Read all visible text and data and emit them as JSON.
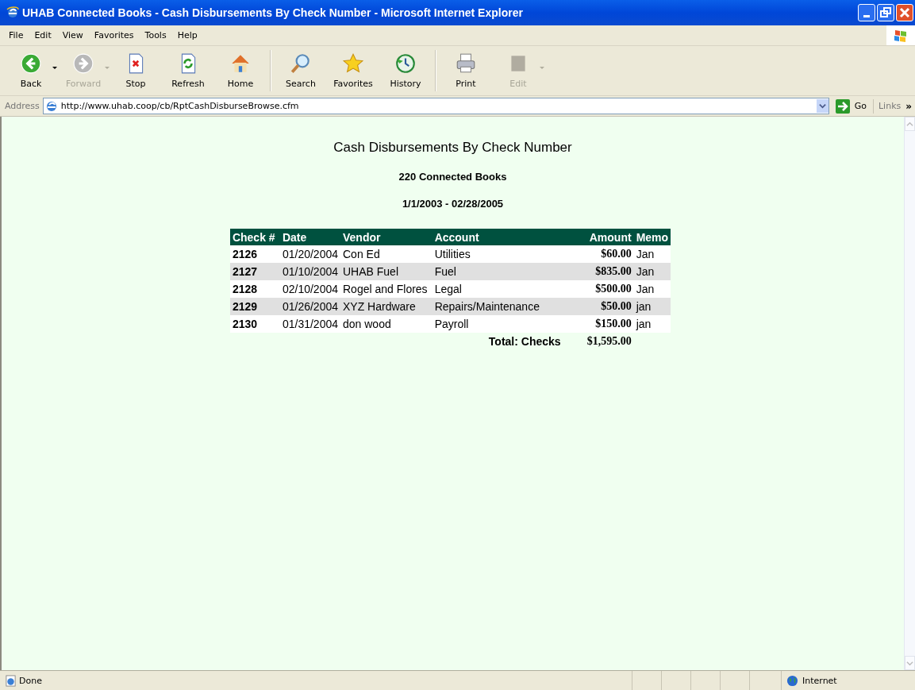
{
  "window": {
    "title": "UHAB Connected Books - Cash Disbursements By Check Number - Microsoft Internet Explorer"
  },
  "menu": [
    "File",
    "Edit",
    "View",
    "Favorites",
    "Tools",
    "Help"
  ],
  "toolbar": [
    [
      {
        "label": "Back",
        "kind": "back",
        "disabled": false,
        "has_menu": true
      },
      {
        "label": "Forward",
        "kind": "forward",
        "disabled": true,
        "has_menu": true
      },
      {
        "label": "Stop",
        "kind": "stop",
        "disabled": false,
        "has_menu": false
      },
      {
        "label": "Refresh",
        "kind": "refresh",
        "disabled": false,
        "has_menu": false
      },
      {
        "label": "Home",
        "kind": "home",
        "disabled": false,
        "has_menu": false
      }
    ],
    [
      {
        "label": "Search",
        "kind": "search",
        "disabled": false,
        "has_menu": false
      },
      {
        "label": "Favorites",
        "kind": "favorites",
        "disabled": false,
        "has_menu": false
      },
      {
        "label": "History",
        "kind": "history",
        "disabled": false,
        "has_menu": false
      }
    ],
    [
      {
        "label": "Print",
        "kind": "print",
        "disabled": false,
        "has_menu": false
      },
      {
        "label": "Edit",
        "kind": "edit",
        "disabled": true,
        "has_menu": true
      }
    ]
  ],
  "address": {
    "label": "Address",
    "value": "http://www.uhab.coop/cb/RptCashDisburseBrowse.cfm",
    "go": "Go",
    "links": "Links",
    "more": "»"
  },
  "report": {
    "title": "Cash Disbursements By Check Number",
    "subtitle": "220 Connected Books",
    "period": "1/1/2003 - 02/28/2005",
    "table": {
      "columns": [
        "Check #",
        "Date",
        "Vendor",
        "Account",
        "Amount",
        "Memo"
      ],
      "rows": [
        [
          "2126",
          "01/20/2004",
          "Con Ed",
          "Utilities",
          "$60.00",
          "Jan"
        ],
        [
          "2127",
          "01/10/2004",
          "UHAB Fuel",
          "Fuel",
          "$835.00",
          "Jan"
        ],
        [
          "2128",
          "02/10/2004",
          "Rogel and Flores",
          "Legal",
          "$500.00",
          "Jan"
        ],
        [
          "2129",
          "01/26/2004",
          "XYZ Hardware",
          "Repairs/Maintenance",
          "$50.00",
          "jan"
        ],
        [
          "2130",
          "01/31/2004",
          "don wood",
          "Payroll",
          "$150.00",
          "jan"
        ]
      ],
      "total_label": "Total: Checks",
      "total": "$1,595.00"
    }
  },
  "status_bar": {
    "text": "Done",
    "zone": "Internet"
  }
}
